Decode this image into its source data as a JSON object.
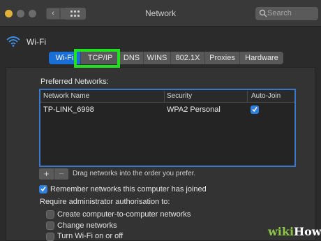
{
  "window": {
    "title": "Network",
    "search_placeholder": "Search",
    "back_glyph": "‹",
    "forward_glyph": "›"
  },
  "header": {
    "wifi_label": "Wi-Fi"
  },
  "tabs": [
    {
      "label": "Wi-Fi",
      "active": true
    },
    {
      "label": "TCP/IP",
      "active": false
    },
    {
      "label": "DNS",
      "active": false
    },
    {
      "label": "WINS",
      "active": false
    },
    {
      "label": "802.1X",
      "active": false
    },
    {
      "label": "Proxies",
      "active": false
    },
    {
      "label": "Hardware",
      "active": false
    }
  ],
  "preferred_networks": {
    "label": "Preferred Networks:",
    "columns": [
      "Network Name",
      "Security",
      "Auto-Join"
    ],
    "rows": [
      {
        "name": "TP-LINK_6998",
        "security": "WPA2 Personal",
        "auto_join": true
      }
    ]
  },
  "list_controls": {
    "add_glyph": "+",
    "remove_glyph": "−",
    "hint": "Drag networks into the order you prefer."
  },
  "options": {
    "remember": {
      "label": "Remember networks this computer has joined",
      "checked": true
    },
    "require_admin_label": "Require administrator authorisation to:",
    "admin_items": [
      {
        "label": "Create computer-to-computer networks",
        "checked": false
      },
      {
        "label": "Change networks",
        "checked": false
      },
      {
        "label": "Turn Wi-Fi on or off",
        "checked": false
      }
    ]
  },
  "watermark": {
    "wiki": "wiki",
    "how": "How"
  },
  "colors": {
    "accent": "#1a6fd6",
    "highlight": "#1ee31e",
    "background": "#2b2b2b"
  }
}
